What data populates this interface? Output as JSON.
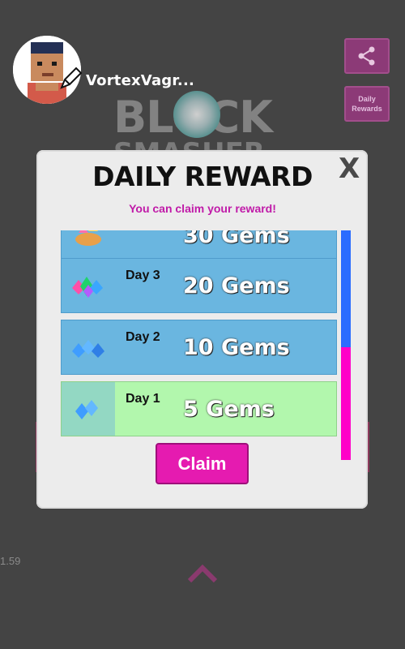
{
  "profile": {
    "username": "VortexVagr..."
  },
  "top_buttons": {
    "daily_rewards_label": "Daily Rewards"
  },
  "logo": {
    "line1": "BLOCK",
    "line2": "SMASHER"
  },
  "version": "1.59",
  "modal": {
    "title": "DAILY REWARD",
    "close_label": "X",
    "subtitle": "You can claim your reward!",
    "rewards": [
      {
        "day": "",
        "amount": "30 Gems"
      },
      {
        "day": "Day 3",
        "amount": "20 Gems"
      },
      {
        "day": "Day 2",
        "amount": "10 Gems"
      },
      {
        "day": "Day 1",
        "amount": "5 Gems",
        "state": "claimable"
      }
    ],
    "claim_label": "Claim"
  },
  "colors": {
    "accent": "#e51bb0",
    "row_blue": "#6ab6e0",
    "row_green": "#b2f7ad",
    "scroll_thumb": "#2a6cff",
    "subtitle": "#c01aa8"
  },
  "icons": [
    "share-icon",
    "pencil-icon",
    "gem-icon",
    "chevron-up-icon"
  ]
}
